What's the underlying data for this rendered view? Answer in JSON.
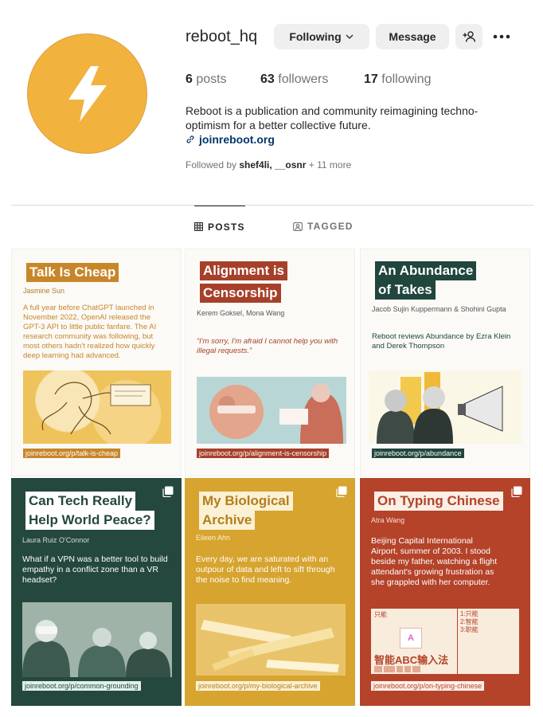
{
  "profile": {
    "username": "reboot_hq",
    "following_label": "Following",
    "message_label": "Message",
    "stats": [
      {
        "num": "6",
        "label": "posts"
      },
      {
        "num": "63",
        "label": "followers"
      },
      {
        "num": "17",
        "label": "following"
      }
    ],
    "bio": "Reboot is a publication and community reimagining techno-optimism for a better collective future.",
    "link": "joinreboot.org",
    "followed_by_prefix": "Followed by",
    "followed_by_users": "shef4li, __osnr",
    "followed_by_more": "+ 11 more",
    "avatar_color": "#f1b33e"
  },
  "tabs": [
    {
      "label": "POSTS",
      "icon": "grid-icon",
      "active": true
    },
    {
      "label": "TAGGED",
      "icon": "tag-icon",
      "active": false
    }
  ],
  "posts": [
    {
      "title_lines": [
        "Talk Is Cheap"
      ],
      "author": "Jasmine Sun",
      "body": "A full year before ChatGPT launched in November 2022, OpenAI released the GPT-3 API to little public fanfare. The AI research community was following, but most others hadn't realized how quickly deep learning had advanced.",
      "url": "joinreboot.org/p/talk-is-cheap",
      "accent": "#c7862a"
    },
    {
      "title_lines": [
        "Alignment is",
        "Censorship"
      ],
      "author": "Kerem Goksel, Mona Wang",
      "body": "“I'm sorry, I'm afraid I cannot help you with illegal requests.”",
      "url": "joinreboot.org/p/alignment-is-censorship",
      "accent": "#a7402a"
    },
    {
      "title_lines": [
        "An Abundance",
        "of Takes"
      ],
      "author": "Jacob Sujin Kuppermann & Shohini Gupta",
      "body": "Reboot reviews Abundance by Ezra Klein and Derek Thompson",
      "url": "joinreboot.org/p/abundance",
      "accent": "#21463d"
    },
    {
      "title_lines": [
        "Can Tech Really",
        "Help World Peace?"
      ],
      "author": "Laura Ruiz O'Connor",
      "body": "What if a VPN was a better tool to build empathy in a conflict zone than a VR headset?",
      "url": "joinreboot.org/p/common-grounding",
      "accent": "#24483e"
    },
    {
      "title_lines": [
        "My Biological",
        "Archive"
      ],
      "author": "Eileen Ahn",
      "body": "Every day, we are saturated with an outpour of data and left to sift through the noise to find meaning.",
      "url": "joinreboot.org/p/my-biological-archive",
      "accent": "#d6a42f"
    },
    {
      "title_lines": [
        "On Typing Chinese"
      ],
      "author": "Atra Wang",
      "body": "Beijing Capital International Airport, summer of 2003. I stood beside my father, watching a flight attendant's growing frustration as she grappled with her computer.",
      "url": "joinreboot.org/p/on-typing-chinese",
      "accent": "#b4432a",
      "ime_text": "智能ABC输入法",
      "ime_small": "只能",
      "ime_list": [
        "1:只能",
        "2:智能",
        "3:职能"
      ]
    }
  ]
}
